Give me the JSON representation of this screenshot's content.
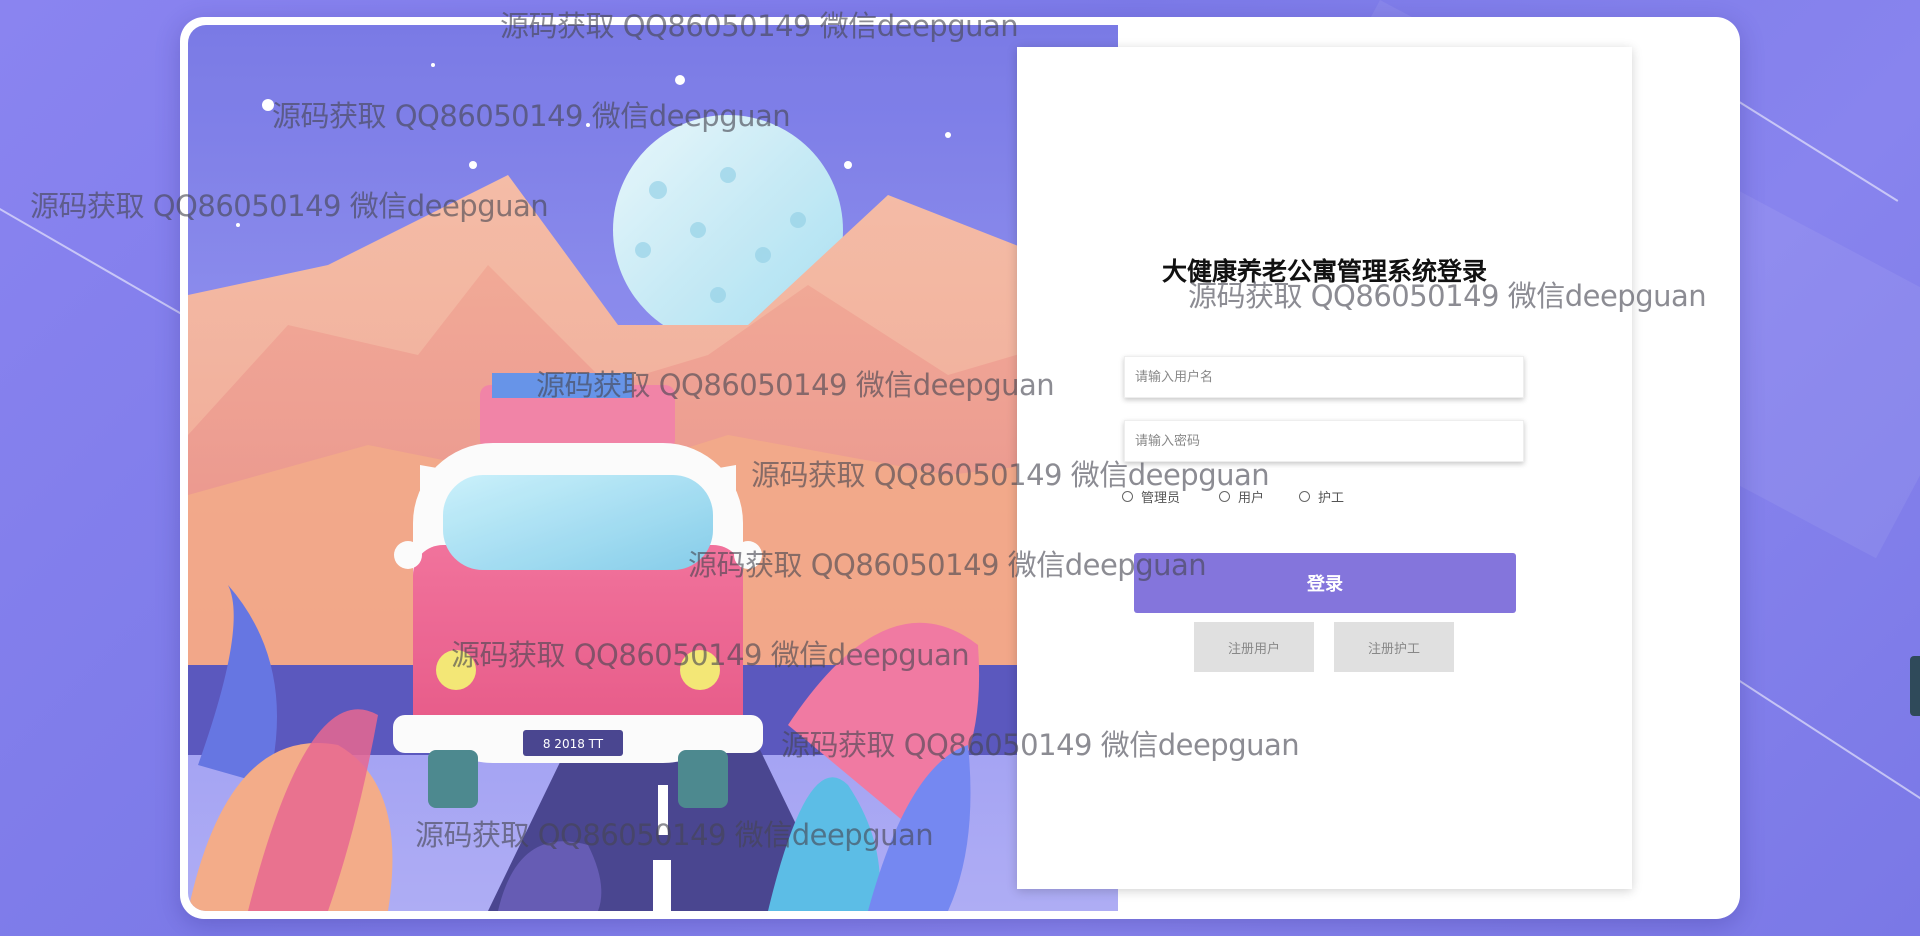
{
  "form": {
    "title": "大健康养老公寓管理系统登录",
    "username_placeholder": "请输入用户名",
    "password_placeholder": "请输入密码",
    "roles": [
      "管理员",
      "用户",
      "护工"
    ],
    "login_label": "登录",
    "register_user_label": "注册用户",
    "register_nurse_label": "注册护工"
  },
  "illustration": {
    "plate_text": "8 2018 TT"
  },
  "watermark": {
    "text": "源码获取 QQ86050149 微信deepguan"
  },
  "colors": {
    "background": "#7f7de9",
    "accent": "#8475dc",
    "register_button": "#e0e0e0"
  }
}
